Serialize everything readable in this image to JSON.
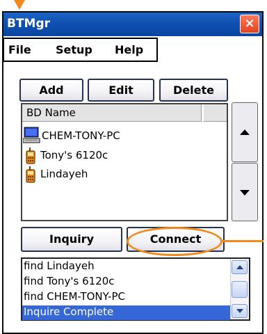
{
  "window": {
    "title": "BTMgr",
    "close_symbol": "×"
  },
  "menu": [
    "File",
    "Setup",
    "Help"
  ],
  "toolbar": {
    "add": "Add",
    "edit": "Edit",
    "delete": "Delete"
  },
  "device_list": {
    "header": "BD Name",
    "items": [
      {
        "name": "CHEM-TONY-PC",
        "icon": "computer-icon"
      },
      {
        "name": "Tony's 6120c",
        "icon": "phone-icon"
      },
      {
        "name": "Lindayeh",
        "icon": "phone-icon"
      }
    ]
  },
  "actions": {
    "inquiry": "Inquiry",
    "connect": "Connect"
  },
  "log": {
    "lines": [
      "find Lindayeh",
      "find Tony's 6120c",
      "find CHEM-TONY-PC",
      "Inquire Complete"
    ],
    "selected_index": 3
  },
  "colors": {
    "annotation": "#f08a1c",
    "titlebar": "#0a46a0",
    "selection": "#3567d6"
  }
}
